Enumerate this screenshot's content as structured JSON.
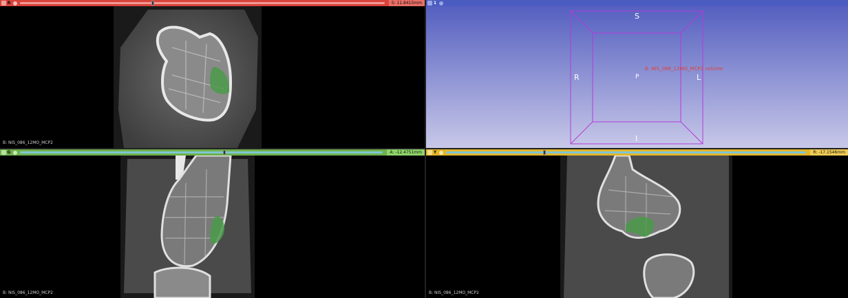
{
  "views": {
    "red": {
      "letter": "R",
      "offset": "S: 11.8415mm",
      "volume_label": "B: NIS_086_12MO_MCP2",
      "color": "#d9423b",
      "slider_fraction": 0.36
    },
    "threeD": {
      "number": "1"
    },
    "green": {
      "letter": "G",
      "offset": "A: -12.4751mm",
      "volume_label": "B: NIS_086_12MO_MCP2",
      "color": "#6fb04c",
      "slider_fraction": 0.56
    },
    "yellow": {
      "letter": "Y",
      "offset": "R: -17.1546mm",
      "volume_label": "B: NIS_086_12MO_MCP2",
      "color": "#e3b52b",
      "slider_fraction": 0.27
    }
  },
  "threeD": {
    "orient_S": "S",
    "orient_I": "I",
    "orient_R": "R",
    "orient_L": "L",
    "orient_P": "P",
    "annotation": "B: NIS_086_12MO_MCP2 volume",
    "box_color": "#b13cd8",
    "bg_top": "#5560c0",
    "bg_bottom": "#c8c8e8"
  },
  "segment_color": "#4a9a4a"
}
